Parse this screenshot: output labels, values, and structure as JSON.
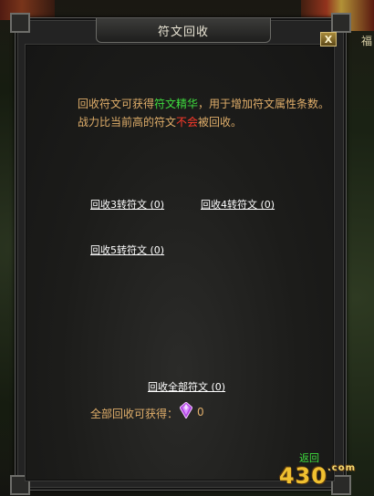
{
  "window": {
    "title": "符文回收",
    "close_label": "X"
  },
  "description": {
    "part1": "回收符文可获得",
    "highlight_green": "符文精华",
    "part2": "，用于增加符文属性条数。战力比当前高的符文",
    "highlight_red": "不会",
    "part3": "被回收。"
  },
  "recycle_links": {
    "tier3": "回收3转符文 (0)",
    "tier4": "回收4转符文 (0)",
    "tier5": "回收5转符文 (0)",
    "all": "回收全部符文 (0)"
  },
  "reward": {
    "label": "全部回收可获得：",
    "icon": "purple-gem-icon",
    "count": "0"
  },
  "back_label": "返回",
  "background": {
    "right_edge_text": "福"
  },
  "watermark": {
    "text": "430",
    "suffix": ".com"
  },
  "colors": {
    "body_text": "#e0ae6a",
    "highlight_green": "#3fdd3f",
    "highlight_red": "#ff3a2a",
    "link": "#ffffff",
    "back": "#3fdd3f"
  }
}
